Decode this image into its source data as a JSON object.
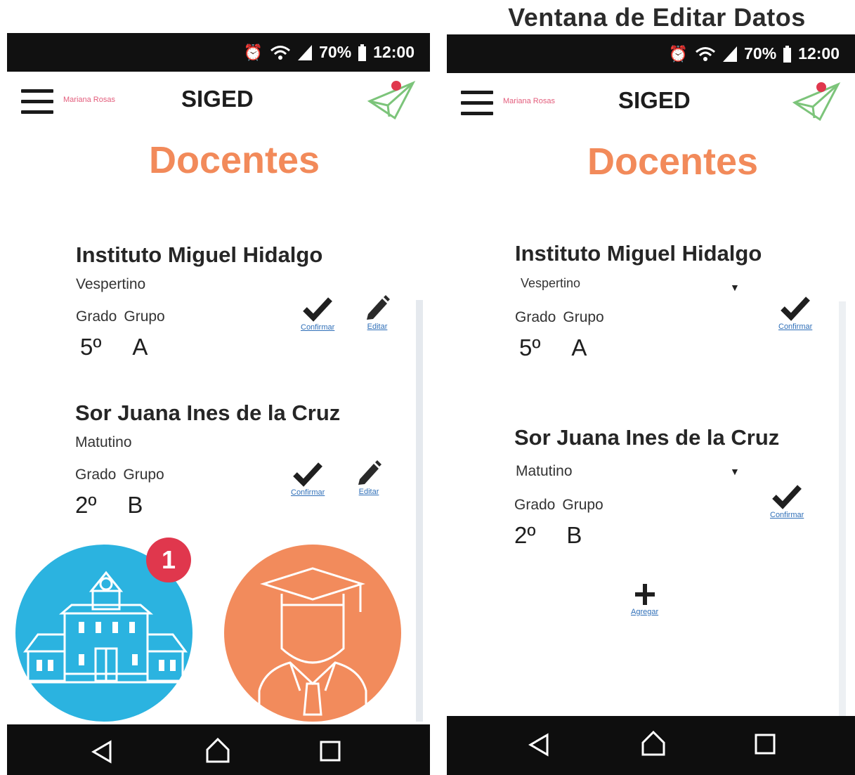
{
  "caption": "Ventana  de Editar Datos",
  "colors": {
    "accent": "#f28a5a",
    "school_circle": "#2bb3e0",
    "grad_circle": "#f28b5c",
    "badge": "#e0374d",
    "link": "#2f6fb8"
  },
  "screens": [
    {
      "status": {
        "battery": "70%",
        "time": "12:00"
      },
      "appbar": {
        "user": "Mariana Rosas",
        "title": "SIGED"
      },
      "section_title": "Docentes",
      "cards": [
        {
          "school": "Instituto Miguel Hidalgo",
          "shift": "Vespertino",
          "grado_label": "Grado",
          "grupo_label": "Grupo",
          "grado": "5º",
          "grupo": "A",
          "confirm": "Confirmar",
          "edit": "Editar"
        },
        {
          "school": "Sor Juana Ines de la Cruz",
          "shift": "Matutino",
          "grado_label": "Grado",
          "grupo_label": "Grupo",
          "grado": "2º",
          "grupo": "B",
          "confirm": "Confirmar",
          "edit": "Editar"
        }
      ],
      "notification_count": "1",
      "icons": [
        "menu-icon",
        "paper-plane-icon",
        "school-building-icon",
        "graduate-icon"
      ]
    },
    {
      "status": {
        "battery": "70%",
        "time": "12:00"
      },
      "appbar": {
        "user": "Mariana Rosas",
        "title": "SIGED"
      },
      "section_title": "Docentes",
      "cards": [
        {
          "school": "Instituto Miguel Hidalgo",
          "shift": "Vespertino",
          "grado_label": "Grado",
          "grupo_label": "Grupo",
          "grado": "5º",
          "grupo": "A",
          "confirm": "Confirmar"
        },
        {
          "school": "Sor Juana Ines de la Cruz",
          "shift": "Matutino",
          "grado_label": "Grado",
          "grupo_label": "Grupo",
          "grado": "2º",
          "grupo": "B",
          "confirm": "Confirmar"
        }
      ],
      "add_label": "Agregar"
    }
  ]
}
